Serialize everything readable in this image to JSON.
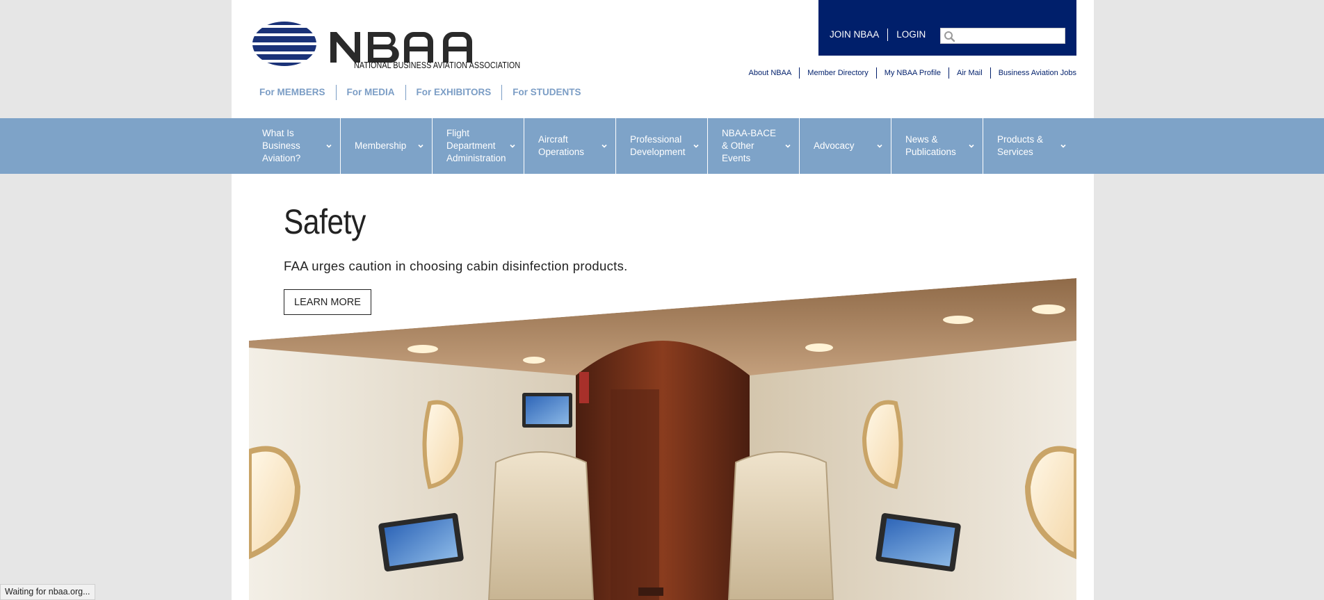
{
  "brand": {
    "name": "NBAA",
    "tagline": "NATIONAL BUSINESS AVIATION ASSOCIATION",
    "primary_color": "#001f6b",
    "nav_color": "#7ea3c8"
  },
  "audience_links": [
    {
      "label": "For MEMBERS"
    },
    {
      "label": "For MEDIA"
    },
    {
      "label": "For EXHIBITORS"
    },
    {
      "label": "For STUDENTS"
    }
  ],
  "account": {
    "join_label": "JOIN NBAA",
    "login_label": "LOGIN",
    "search_placeholder": ""
  },
  "utility_links": [
    {
      "label": "About NBAA"
    },
    {
      "label": "Member Directory"
    },
    {
      "label": "My NBAA Profile"
    },
    {
      "label": "Air Mail"
    },
    {
      "label": "Business Aviation Jobs"
    }
  ],
  "main_nav": [
    {
      "label": "What Is Business Aviation?"
    },
    {
      "label": "Membership"
    },
    {
      "label": "Flight Department Administration"
    },
    {
      "label": "Aircraft Operations"
    },
    {
      "label": "Professional Development"
    },
    {
      "label": "NBAA-BACE & Other Events"
    },
    {
      "label": "Advocacy"
    },
    {
      "label": "News & Publications"
    },
    {
      "label": "Products & Services"
    }
  ],
  "hero": {
    "title": "Safety",
    "subtitle": "FAA urges caution in choosing cabin disinfection products.",
    "cta_label": "LEARN MORE",
    "image_subject": "business-jet-cabin-interior"
  },
  "status_bar": {
    "text": "Waiting for nbaa.org..."
  }
}
